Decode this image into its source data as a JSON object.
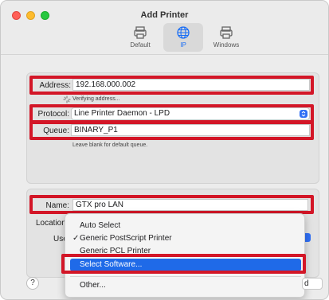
{
  "window": {
    "title": "Add Printer"
  },
  "toolbar": {
    "tabs": [
      {
        "label": "Default",
        "icon": "printer-icon"
      },
      {
        "label": "IP",
        "icon": "globe-icon",
        "active": true
      },
      {
        "label": "Windows",
        "icon": "printer-icon"
      }
    ]
  },
  "form": {
    "address_label": "Address:",
    "address_value": "192.168.000.002",
    "address_status": "Verifying address...",
    "protocol_label": "Protocol:",
    "protocol_value": "Line Printer Daemon - LPD",
    "queue_label": "Queue:",
    "queue_value": "BINARY_P1",
    "queue_hint": "Leave blank for default queue.",
    "name_label": "Name:",
    "name_value": "GTX pro LAN",
    "location_label": "Location",
    "use_label": "Use"
  },
  "use_menu": {
    "items": [
      {
        "label": "Auto Select",
        "checked": false
      },
      {
        "label": "Generic PostScript Printer",
        "checked": true
      },
      {
        "label": "Generic PCL Printer",
        "checked": false
      },
      {
        "label": "Select Software...",
        "selected": true
      },
      {
        "label": "Other...",
        "checked": false
      }
    ]
  },
  "footer": {
    "help_label": "?",
    "add_partial": "d"
  },
  "colors": {
    "highlight_box": "#d31627",
    "accent": "#1f6ae8"
  }
}
